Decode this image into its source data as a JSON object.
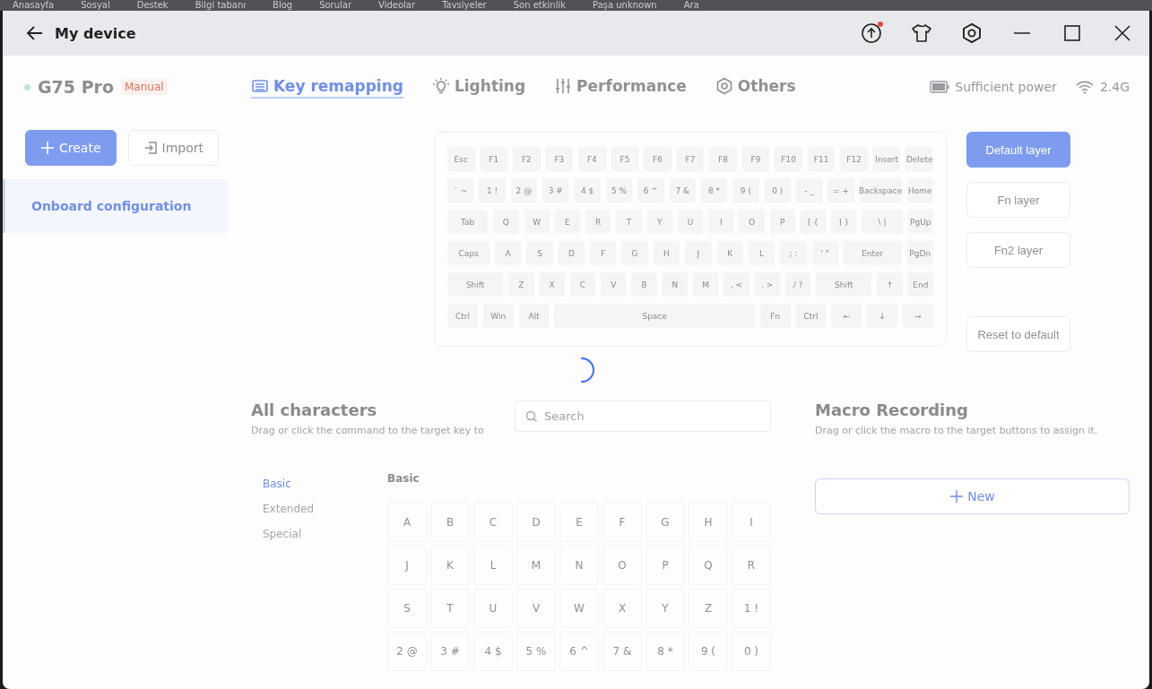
{
  "background_bar": {
    "items": [
      "Anasayfa",
      "Sosyal",
      "Destek",
      "Bilgi tabanı",
      "Blog",
      "Sorular",
      "Videolar",
      "Tavsiyeler",
      "Son etkinlik",
      "Paşa unknown",
      "Ara"
    ]
  },
  "window": {
    "title": "My device",
    "notification_dot": true
  },
  "sidebar": {
    "device": {
      "name": "G75 Pro",
      "mode": "Manual",
      "connected": true
    },
    "buttons": [
      {
        "label": "Create",
        "kind": "primary"
      },
      {
        "label": "Import",
        "kind": "secondary"
      }
    ],
    "items": [
      {
        "label": "Onboard configuration",
        "selected": true
      }
    ]
  },
  "tabs": [
    {
      "label": "Key remapping",
      "selected": true
    },
    {
      "label": "Lighting",
      "selected": false
    },
    {
      "label": "Performance",
      "selected": false
    },
    {
      "label": "Others",
      "selected": false
    }
  ],
  "status": {
    "battery": "Sufficient power",
    "wireless": "2.4G"
  },
  "keyboard": {
    "rows": [
      {
        "keys": [
          {
            "label": "Esc",
            "kind": "normal"
          },
          {
            "label": "F1",
            "kind": "normal"
          },
          {
            "label": "F2",
            "kind": "normal"
          },
          {
            "label": "F3",
            "kind": "normal"
          },
          {
            "label": "F4",
            "kind": "normal"
          },
          {
            "label": "F5",
            "kind": "normal"
          },
          {
            "label": "F6",
            "kind": "normal"
          },
          {
            "label": "F7",
            "kind": "normal"
          },
          {
            "label": "F8",
            "kind": "normal"
          },
          {
            "label": "F9",
            "kind": "normal"
          },
          {
            "label": "F10",
            "kind": "normal"
          },
          {
            "label": "F11",
            "kind": "normal"
          },
          {
            "label": "F12",
            "kind": "normal"
          },
          {
            "label": "Insert",
            "kind": "normal"
          },
          {
            "label": "Delete",
            "kind": "normal"
          }
        ]
      },
      {
        "keys": [
          {
            "label": "` ~",
            "kind": "normal"
          },
          {
            "label": "1 !",
            "kind": "normal"
          },
          {
            "label": "2 @",
            "kind": "normal"
          },
          {
            "label": "3 #",
            "kind": "normal"
          },
          {
            "label": "4 $",
            "kind": "normal"
          },
          {
            "label": "5 %",
            "kind": "normal"
          },
          {
            "label": "6 ^",
            "kind": "normal"
          },
          {
            "label": "7 &",
            "kind": "normal"
          },
          {
            "label": "8 *",
            "kind": "normal"
          },
          {
            "label": "9 (",
            "kind": "normal"
          },
          {
            "label": "0 )",
            "kind": "normal"
          },
          {
            "label": "- _",
            "kind": "normal"
          },
          {
            "label": "= +",
            "kind": "normal"
          },
          {
            "label": "Backspace",
            "kind": "wide"
          },
          {
            "label": "Home",
            "kind": "normal"
          }
        ]
      },
      {
        "keys": [
          {
            "label": "Tab",
            "kind": "wide"
          },
          {
            "label": "Q",
            "kind": "normal"
          },
          {
            "label": "W",
            "kind": "normal"
          },
          {
            "label": "E",
            "kind": "normal"
          },
          {
            "label": "R",
            "kind": "normal"
          },
          {
            "label": "T",
            "kind": "normal"
          },
          {
            "label": "Y",
            "kind": "normal"
          },
          {
            "label": "U",
            "kind": "normal"
          },
          {
            "label": "I",
            "kind": "normal"
          },
          {
            "label": "O",
            "kind": "normal"
          },
          {
            "label": "P",
            "kind": "normal"
          },
          {
            "label": "[ {",
            "kind": "normal"
          },
          {
            "label": "] }",
            "kind": "normal"
          },
          {
            "label": "\\ |",
            "kind": "wide"
          },
          {
            "label": "PgUp",
            "kind": "normal"
          }
        ]
      },
      {
        "keys": [
          {
            "label": "Caps",
            "kind": "wide"
          },
          {
            "label": "A",
            "kind": "normal"
          },
          {
            "label": "S",
            "kind": "normal"
          },
          {
            "label": "D",
            "kind": "normal"
          },
          {
            "label": "F",
            "kind": "normal"
          },
          {
            "label": "G",
            "kind": "normal"
          },
          {
            "label": "H",
            "kind": "normal"
          },
          {
            "label": "J",
            "kind": "normal"
          },
          {
            "label": "K",
            "kind": "normal"
          },
          {
            "label": "L",
            "kind": "normal"
          },
          {
            "label": "; :",
            "kind": "normal"
          },
          {
            "label": "' \"",
            "kind": "normal"
          },
          {
            "label": "Enter",
            "kind": "wider"
          },
          {
            "label": "PgDn",
            "kind": "normal"
          }
        ]
      },
      {
        "keys": [
          {
            "label": "Shift",
            "kind": "wider"
          },
          {
            "label": "Z",
            "kind": "normal"
          },
          {
            "label": "X",
            "kind": "normal"
          },
          {
            "label": "C",
            "kind": "normal"
          },
          {
            "label": "V",
            "kind": "normal"
          },
          {
            "label": "B",
            "kind": "normal"
          },
          {
            "label": "N",
            "kind": "normal"
          },
          {
            "label": "M",
            "kind": "normal"
          },
          {
            "label": ", <",
            "kind": "normal"
          },
          {
            "label": ". >",
            "kind": "normal"
          },
          {
            "label": "/ ?",
            "kind": "normal"
          },
          {
            "label": "Shift",
            "kind": "wider"
          },
          {
            "label": "↑",
            "kind": "normal"
          },
          {
            "label": "End",
            "kind": "normal"
          }
        ]
      },
      {
        "keys": [
          {
            "label": "Ctrl",
            "kind": "normal"
          },
          {
            "label": "Win",
            "kind": "normal"
          },
          {
            "label": "Alt",
            "kind": "normal"
          },
          {
            "label": "Space",
            "kind": "space"
          },
          {
            "label": "Fn",
            "kind": "normal"
          },
          {
            "label": "Ctrl",
            "kind": "normal"
          },
          {
            "label": "←",
            "kind": "normal"
          },
          {
            "label": "↓",
            "kind": "normal"
          },
          {
            "label": "→",
            "kind": "normal"
          }
        ]
      }
    ]
  },
  "layers": [
    {
      "label": "Default layer",
      "selected": true
    },
    {
      "label": "Fn layer",
      "selected": false
    },
    {
      "label": "Fn2 layer",
      "selected": false
    }
  ],
  "reset_button": "Reset to default",
  "loading": true,
  "characters": {
    "title": "All characters",
    "subtitle": "Drag or click the command to the target key to",
    "search": {
      "placeholder": "Search"
    },
    "categories": [
      {
        "label": "Basic",
        "selected": true
      },
      {
        "label": "Extended",
        "selected": false
      },
      {
        "label": "Special",
        "selected": false
      }
    ],
    "group_title": "Basic",
    "items": [
      "A",
      "B",
      "C",
      "D",
      "E",
      "F",
      "G",
      "H",
      "I",
      "J",
      "K",
      "L",
      "M",
      "N",
      "O",
      "P",
      "Q",
      "R",
      "S",
      "T",
      "U",
      "V",
      "W",
      "X",
      "Y",
      "Z",
      "1 !",
      "2 @",
      "3 #",
      "4 $",
      "5 %",
      "6 ^",
      "7 &",
      "8 *",
      "9 (",
      "0 )"
    ]
  },
  "macro": {
    "title": "Macro Recording",
    "subtitle": "Drag or click the macro to the target buttons to assign it.",
    "new_button": "New"
  }
}
